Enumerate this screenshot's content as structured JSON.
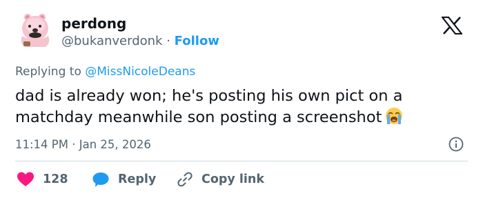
{
  "author": {
    "display_name": "perdong",
    "handle": "@bukanverdonk",
    "separator": "·",
    "follow_label": "Follow"
  },
  "reply_context": {
    "prefix": "Replying to",
    "mention": "@MissNicoleDeans"
  },
  "tweet": {
    "text": "dad is already won; he's posting his own pict on a matchday meanwhile son posting a screenshot",
    "emoji": "loudly-crying-face"
  },
  "meta": {
    "time": "11:14 PM",
    "separator": "·",
    "date": "Jan 25, 2026"
  },
  "actions": {
    "like_count": "128",
    "reply_label": "Reply",
    "copy_label": "Copy link"
  },
  "colors": {
    "accent": "#1d9bf0",
    "like": "#f91880",
    "muted": "#536471",
    "text": "#0f1419"
  },
  "icons": [
    "avatar-bear",
    "x-logo-icon",
    "info-icon",
    "heart-icon",
    "reply-bubble-icon",
    "link-icon"
  ]
}
